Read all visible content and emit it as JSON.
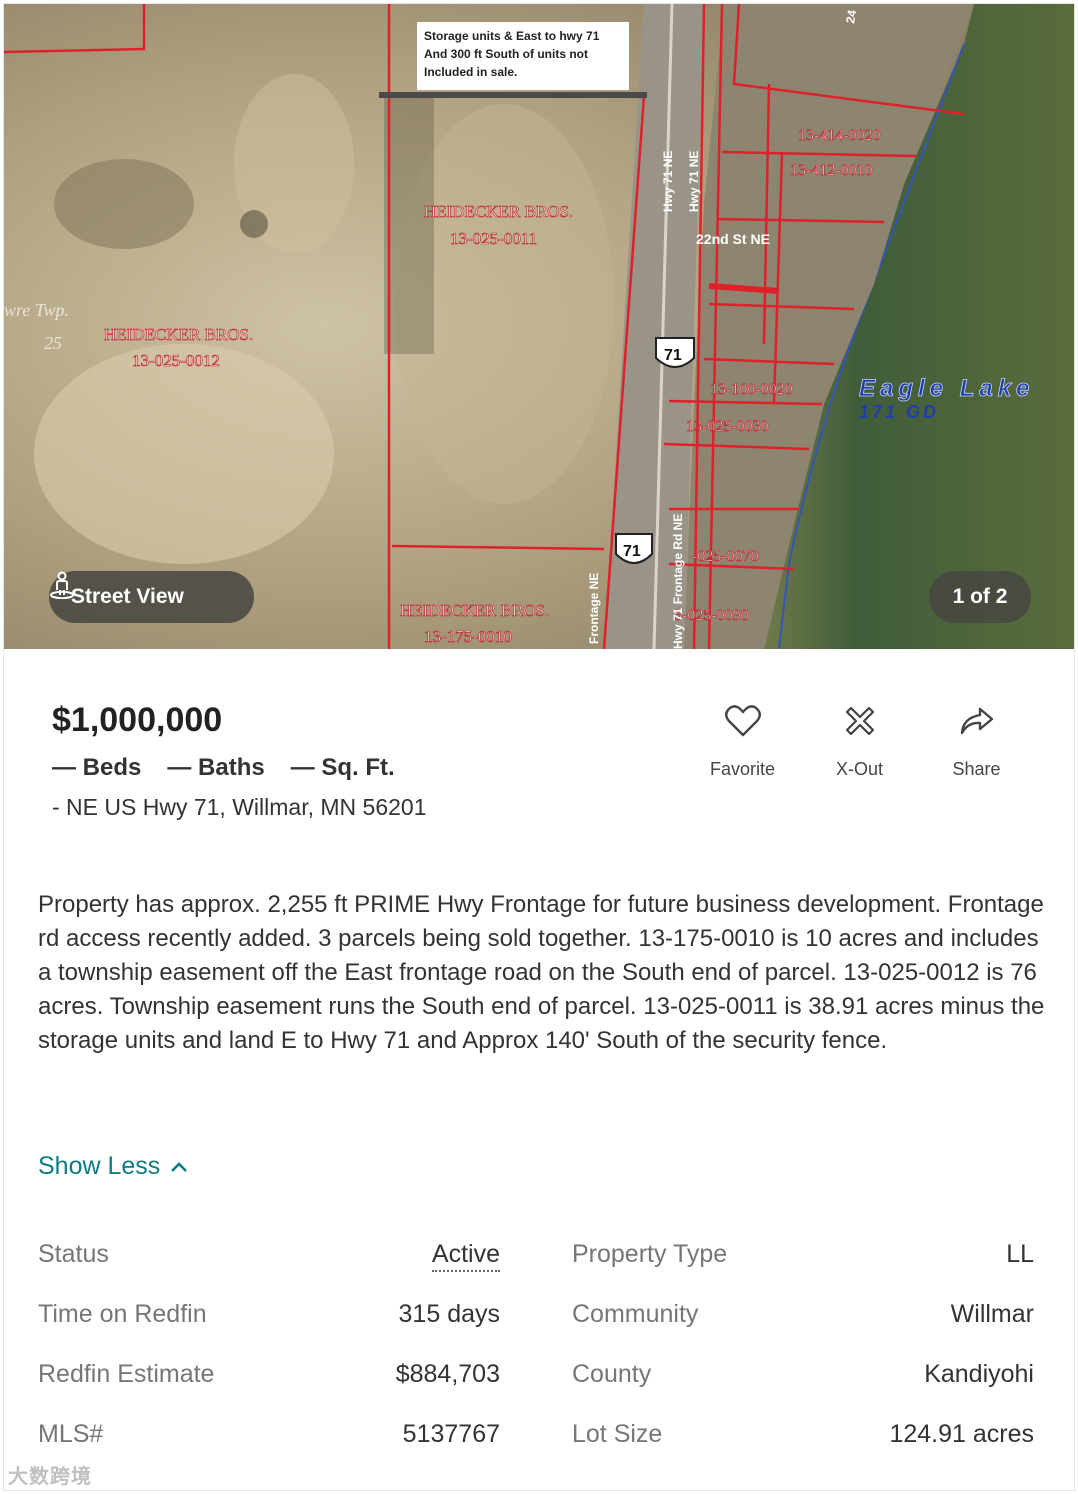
{
  "photo": {
    "street_view_label": "Street View",
    "counter": "1 of 2",
    "map_labels": {
      "notice": [
        "Storage units & East to hwy 71",
        "And 300 ft South of units not",
        "Included in sale."
      ],
      "owner1": "HEIDECKER BROS.",
      "parcel1": "13-025-0011",
      "owner2": "HEIDECKER BROS.",
      "parcel2": "13-025-0012",
      "owner3": "HEIDECKER BROS.",
      "parcel3": "13-175-0010",
      "twp": "wre Twp.",
      "twp_num": "25",
      "road1": "Hwy 71 NE",
      "road2": "Hwy 71 NE",
      "street": "22nd St NE",
      "hwy_shield": "71",
      "frontage1": "Frontage NE",
      "frontage2": "Hwy 71 Frontage Rd NE",
      "lake": "Eagle Lake",
      "lake_code": "171 GD",
      "p_a": "13-414-0020",
      "p_b": "13-412-0010",
      "p_c": "13-100-0020",
      "p_d": "13-025-0030",
      "p_e": "-025-0070",
      "p_f": "3-025-0090",
      "p_g": "24"
    }
  },
  "header": {
    "price": "$1,000,000",
    "beds": "— Beds",
    "baths": "— Baths",
    "sqft": "— Sq. Ft.",
    "address": "- NE US Hwy 71, Willmar, MN 56201"
  },
  "actions": {
    "favorite": "Favorite",
    "xout": "X-Out",
    "share": "Share"
  },
  "description": "Property has approx. 2,255 ft PRIME Hwy Frontage for future business development. Frontage rd access recently added. 3 parcels being sold together. 13-175-0010 is 10 acres and includes a township easement off the East frontage road on the South end of parcel. 13-025-0012 is 76 acres. Township easement runs the South end of parcel. 13-025-0011 is 38.91 acres minus the storage units and land E to Hwy 71 and Approx 140' South of the security fence.",
  "show_less": "Show Less",
  "details": {
    "status_k": "Status",
    "status_v": "Active",
    "time_k": "Time on Redfin",
    "time_v": "315 days",
    "estimate_k": "Redfin Estimate",
    "estimate_v": "$884,703",
    "mls_k": "MLS#",
    "mls_v": "5137767",
    "type_k": "Property Type",
    "type_v": "LL",
    "community_k": "Community",
    "community_v": "Willmar",
    "county_k": "County",
    "county_v": "Kandiyohi",
    "lot_k": "Lot Size",
    "lot_v": "124.91 acres"
  },
  "colors": {
    "accent": "#0f7a82",
    "parcel_line": "#e0202a"
  },
  "watermark": "大数跨境"
}
